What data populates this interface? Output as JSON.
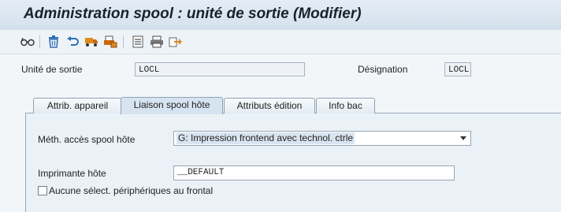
{
  "header": {
    "title": "Administration spool : unité de sortie (Modifier)"
  },
  "toolbar": {
    "icons": [
      "glasses-icon",
      "trash-icon",
      "undo-icon",
      "truck-icon",
      "printer-queue-icon",
      "list-icon",
      "printer-icon",
      "export-icon"
    ]
  },
  "form": {
    "output_device_label": "Unité de sortie",
    "output_device_value": "LOCL",
    "designation_label": "Désignation",
    "designation_value": "LOCL"
  },
  "tabs": [
    {
      "label": "Attrib. appareil",
      "active": false
    },
    {
      "label": "Liaison spool hôte",
      "active": true
    },
    {
      "label": "Attributs édition",
      "active": false
    },
    {
      "label": "Info bac",
      "active": false
    }
  ],
  "panel": {
    "access_method_label": "Méth. accès spool hôte",
    "access_method_value": "G: Impression frontend avec technol. ctrle",
    "host_printer_label": "Imprimante hôte",
    "host_printer_value": "__DEFAULT",
    "checkbox_label": "Aucune sélect. périphériques au frontal",
    "checkbox_checked": false
  },
  "colors": {
    "title_bar": "#d3e0ec",
    "panel": "#eaf1f7",
    "accent": "#1f5fa8"
  }
}
